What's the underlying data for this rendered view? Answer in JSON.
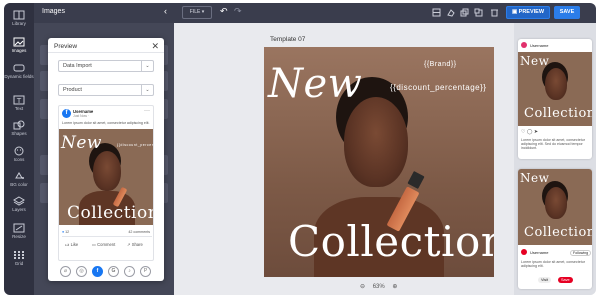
{
  "rail": [
    {
      "label": "Library",
      "icon": "library-icon"
    },
    {
      "label": "Images",
      "icon": "image-icon"
    },
    {
      "label": "Dynamic fields",
      "icon": "dynamic-fields-icon"
    },
    {
      "label": "Text",
      "icon": "text-icon"
    },
    {
      "label": "Shapes",
      "icon": "shapes-icon"
    },
    {
      "label": "Icons",
      "icon": "smiley-icon"
    },
    {
      "label": "BG color",
      "icon": "bg-color-icon"
    },
    {
      "label": "Layers",
      "icon": "layers-icon"
    },
    {
      "label": "Resize",
      "icon": "resize-icon"
    },
    {
      "label": "Grid",
      "icon": "grid-icon"
    }
  ],
  "topbar": {
    "panel_title": "Images",
    "file_label": "FILE",
    "preview_label": "PREVIEW",
    "save_label": "SAVE"
  },
  "canvas": {
    "template_title": "Template 07",
    "brand_field": "{{Brand}}",
    "discount_field": "{{discount_percentage}}",
    "headline_top": "New",
    "headline_bottom": "Collection",
    "zoom_level": "63%"
  },
  "modal": {
    "title": "Preview",
    "select_source": "Data Import",
    "select_type": "Product",
    "post": {
      "username": "Username",
      "timestamp": "Just Now · ",
      "caption": "Lorem ipsum dolor sit amet, consectetur adipiscing elit.",
      "reactions_count": "12",
      "comments_count": "42 comments",
      "like_label": "Like",
      "comment_label": "Comment",
      "share_label": "Share"
    },
    "networks": [
      "pinterest-icon",
      "instagram-icon",
      "facebook-icon",
      "google-icon",
      "tiktok-icon",
      "pinterest-alt-icon"
    ]
  },
  "thumbnails": [
    {
      "network": "instagram",
      "username": "Username",
      "caption": "Lorem ipsum dolor sit amet, consectetur adipiscing elit. Sed do eiusmod tempor incididunt."
    },
    {
      "network": "pinterest",
      "username": "Username",
      "follow_label": "Following",
      "caption": "Lorem ipsum dolor sit amet, consectetur adipiscing elit.",
      "visit_label": "Visit",
      "save_label": "Save"
    }
  ],
  "colors": {
    "rail_bg": "#2f3140",
    "topbar_bg": "#3a3d4d",
    "accent": "#2b7de9",
    "artboard_bg": "#8a6a55",
    "facebook_blue": "#1877f2",
    "pinterest_red": "#e60023"
  }
}
